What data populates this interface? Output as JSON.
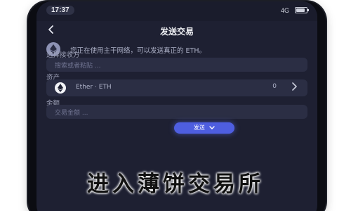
{
  "status_bar": {
    "time": "17:37",
    "network": "4G"
  },
  "nav": {
    "back_icon": "chevron-left-icon",
    "title": "发送交易"
  },
  "notice": {
    "icon": "ethereum-icon",
    "text": "您正在使用主干网络，可以发送真正的 ETH。"
  },
  "network_select": {
    "label": "选择接收方",
    "placeholder": "搜索或者粘贴 ..."
  },
  "asset": {
    "label": "资产",
    "name": "Ether · ETH",
    "balance": "0"
  },
  "amount": {
    "label": "金额",
    "placeholder": "交易金额 ..."
  },
  "send_button": {
    "label": "发送"
  },
  "overlay": {
    "text": "进入薄饼交易所"
  },
  "colors": {
    "screen_bg": "#1e2032",
    "field_bg": "#2b2e44",
    "accent": "#4e5ee0"
  }
}
